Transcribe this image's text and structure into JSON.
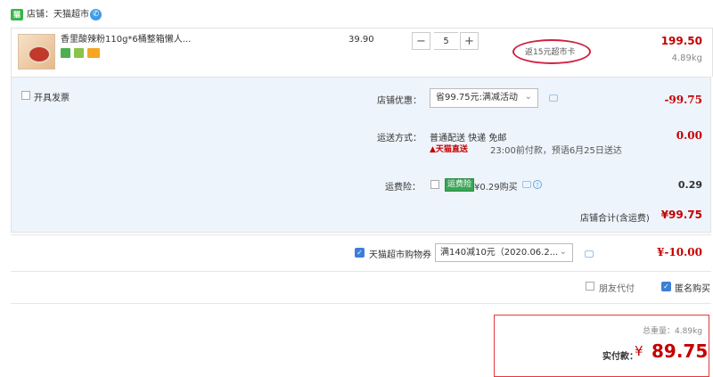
{
  "store": {
    "label": "店铺：天猫超市",
    "icon": "tmall-store-icon"
  },
  "item": {
    "title": "香里酸辣粉110g*6桶整箱懒人...",
    "unit_price": "39.90",
    "quantity": "5",
    "rebate": "返15元超市卡",
    "subtotal": "199.50",
    "weight": "4.89kg"
  },
  "order": {
    "invoice_label": "开具发票",
    "store_discount_label": "店铺优惠：",
    "store_discount_value": "省99.75元:满减活动",
    "store_discount_amount": "-99.75",
    "shipping_label": "运送方式：",
    "shipping_value": "普通配送 快递 免邮",
    "tmall_direct": "天猫直送",
    "delivery_time": "23:00前付款，预语6月25日送达",
    "shipping_amount": "0.00",
    "insurance_label": "运费险：",
    "insurance_badge": "运费险",
    "insurance_price": "¥0.29购买",
    "insurance_amount": "0.29",
    "store_total_label": "店铺合计(含运费)",
    "store_total": "¥99.75"
  },
  "mall_coupon": {
    "label": "天猫超市购物券",
    "selected": "满140减10元（2020.06.2...",
    "amount": "¥-10.00",
    "checked": true
  },
  "options": {
    "friend_pay": "朋友代付",
    "anonymous": "匿名购买",
    "anonymous_checked": true
  },
  "summary": {
    "total_weight": "总重量：4.89kg",
    "pay_label": "实付款：",
    "currency": "¥",
    "amount": "89.75"
  },
  "colors": {
    "price_red": "#c40000",
    "accent_blue": "#3d7fd6",
    "panel_bg": "#eef4fb"
  }
}
